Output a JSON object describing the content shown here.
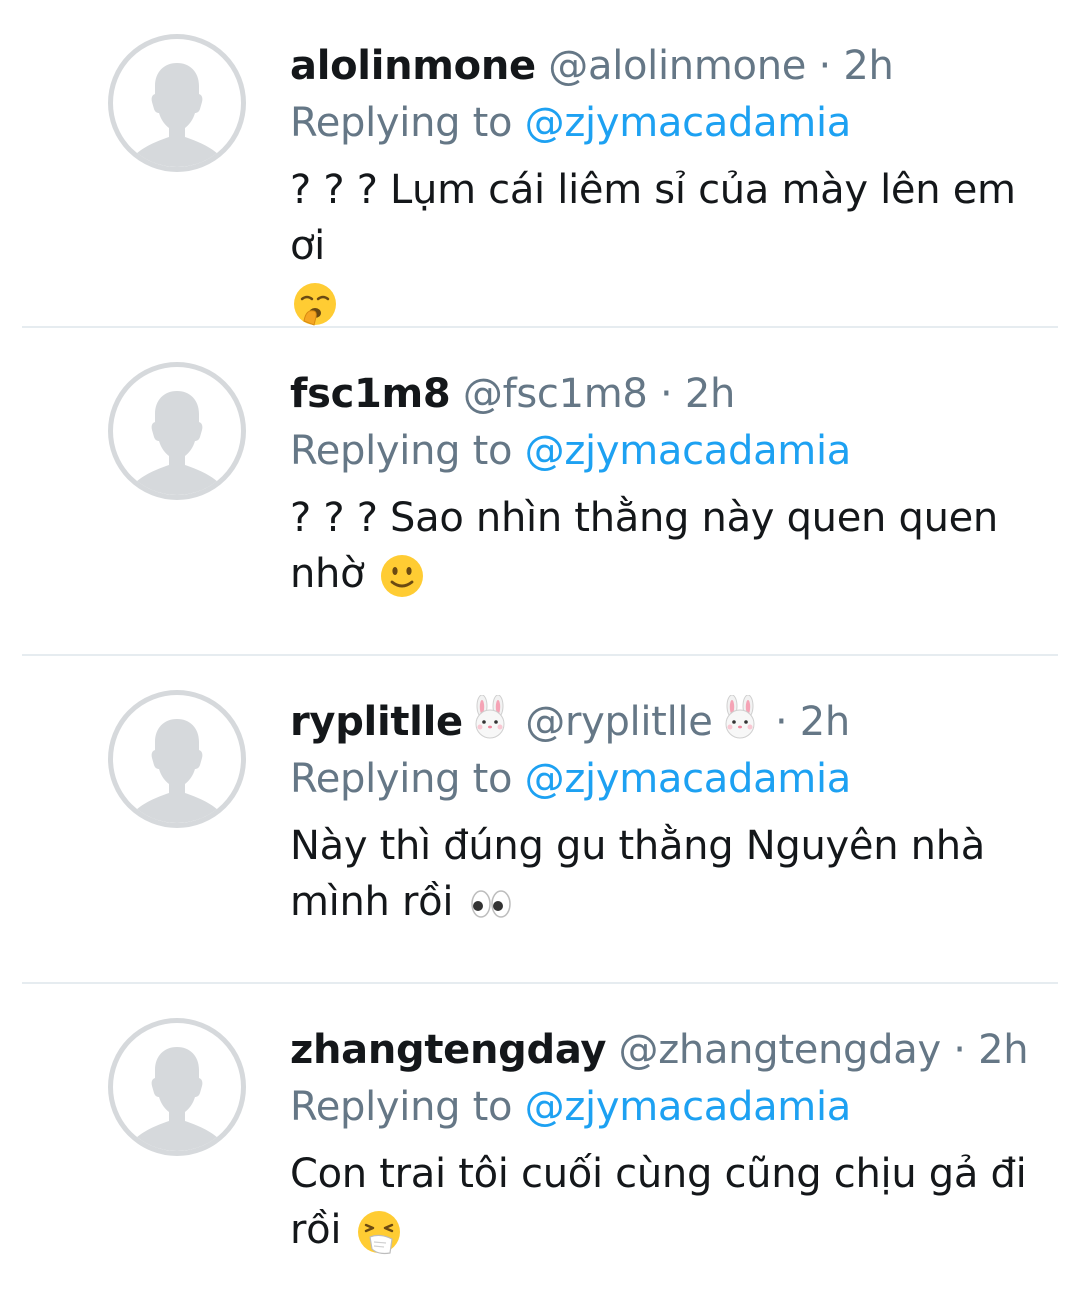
{
  "replies": [
    {
      "display_name": "alolinmone",
      "handle": "@alolinmone",
      "separator": "·",
      "time": "2h",
      "replying_prefix": "Replying to",
      "replying_to": "@zjymacadamia",
      "text": "? ? ? Lụm cái liêm sỉ của mày lên em ơi",
      "emoji": "yawning-face-icon"
    },
    {
      "display_name": "fsc1m8",
      "handle": "@fsc1m8",
      "separator": "·",
      "time": "2h",
      "replying_prefix": "Replying to",
      "replying_to": "@zjymacadamia",
      "text": "? ? ? Sao nhìn thằng này quen quen nhờ",
      "emoji": "slightly-smiling-face-icon"
    },
    {
      "display_name": "ryplitlle",
      "handle": "@ryplitlle",
      "separator": "·",
      "time": "2h",
      "replying_prefix": "Replying to",
      "replying_to": "@zjymacadamia",
      "text": "Này thì đúng gu thằng Nguyên nhà mình rồi",
      "emoji": "eyes-icon",
      "name_emoji": "rabbit-face-icon"
    },
    {
      "display_name": "zhangtengday",
      "handle": "@zhangtengday",
      "separator": "·",
      "time": "2h",
      "replying_prefix": "Replying to",
      "replying_to": "@zjymacadamia",
      "text": "Con trai tôi cuối cùng cũng chịu gả đi rồi",
      "emoji": "sneezing-face-icon"
    }
  ],
  "colors": {
    "name": "#14171a",
    "secondary": "#657786",
    "link": "#1da1f2",
    "divider": "#e6ecf0",
    "avatar_placeholder": "#d6d9dc"
  }
}
